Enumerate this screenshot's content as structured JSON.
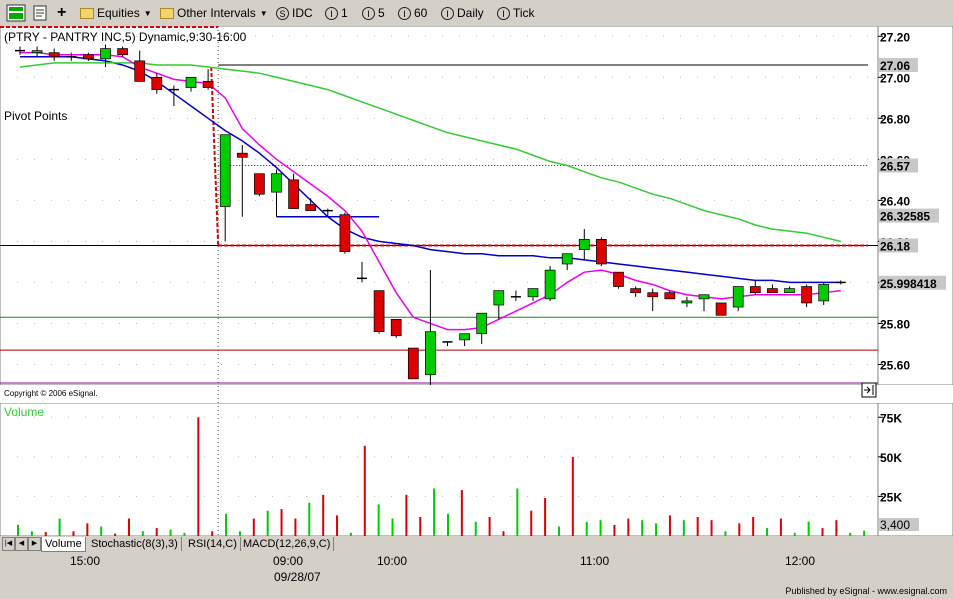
{
  "toolbar": {
    "equities_label": "Equities",
    "intervals_label": "Other Intervals",
    "symbol_btn": "IDC",
    "interval_1": "1",
    "interval_5": "5",
    "interval_60": "60",
    "interval_daily": "Daily",
    "interval_tick": "Tick",
    "symbol_icon": "S",
    "interval_icon": "I"
  },
  "chart": {
    "header": "(PTRY - PANTRY INC,5) Dynamic,9:30-16:00",
    "study_label": "Pivot Points",
    "copyright": "Copyright © 2006 eSignal.",
    "price_ticks": [
      "27.20",
      "27.00",
      "26.80",
      "26.60",
      "26.40",
      "26.20",
      "26.00",
      "25.80",
      "25.60"
    ],
    "price_badges": [
      {
        "label": "27.06",
        "value": 27.06
      },
      {
        "label": "26.57",
        "value": 26.57
      },
      {
        "label": "26.32585",
        "value": 26.32585
      },
      {
        "label": "26.18",
        "value": 26.18
      },
      {
        "label": "25.998418",
        "value": 25.998418
      }
    ]
  },
  "volume": {
    "label": "Volume",
    "ticks": [
      "75K",
      "50K",
      "25K"
    ],
    "last_value": "3,400"
  },
  "tabs": {
    "items": [
      "Volume",
      "Stochastic(8(3),3)",
      "RSI(14,C)",
      "MACD(12,26,9,C)"
    ]
  },
  "xaxis": {
    "labels": [
      "15:00",
      "09:00",
      "10:00",
      "11:00",
      "12:00"
    ],
    "date": "09/28/07"
  },
  "footer": {
    "text": "Published by eSignal - www.esignal.com"
  },
  "colors": {
    "up": "#00cc00",
    "down": "#dd0000",
    "ma_blue": "#0000cc",
    "ma_green": "#33cc33",
    "ma_magenta": "#ee00ee"
  },
  "chart_data": {
    "type": "candlestick",
    "title": "(PTRY - PANTRY INC,5) Dynamic,9:30-16:00",
    "ylim": [
      25.5,
      27.25
    ],
    "candles": [
      {
        "o": 27.13,
        "h": 27.15,
        "l": 27.11,
        "c": 27.13
      },
      {
        "o": 27.12,
        "h": 27.15,
        "l": 27.1,
        "c": 27.13
      },
      {
        "o": 27.12,
        "h": 27.14,
        "l": 27.08,
        "c": 27.1
      },
      {
        "o": 27.1,
        "h": 27.12,
        "l": 27.08,
        "c": 27.1
      },
      {
        "o": 27.11,
        "h": 27.12,
        "l": 27.08,
        "c": 27.09
      },
      {
        "o": 27.09,
        "h": 27.16,
        "l": 27.05,
        "c": 27.14
      },
      {
        "o": 27.14,
        "h": 27.15,
        "l": 27.1,
        "c": 27.11
      },
      {
        "o": 27.08,
        "h": 27.13,
        "l": 26.98,
        "c": 26.98
      },
      {
        "o": 27.0,
        "h": 27.02,
        "l": 26.92,
        "c": 26.94
      },
      {
        "o": 26.94,
        "h": 26.96,
        "l": 26.86,
        "c": 26.94
      },
      {
        "o": 26.95,
        "h": 27.0,
        "l": 26.93,
        "c": 27.0
      },
      {
        "o": 26.98,
        "h": 27.04,
        "l": 26.94,
        "c": 26.95
      },
      {
        "o": 26.37,
        "h": 26.72,
        "l": 26.2,
        "c": 26.72
      },
      {
        "o": 26.63,
        "h": 26.67,
        "l": 26.32,
        "c": 26.61
      },
      {
        "o": 26.53,
        "h": 26.53,
        "l": 26.42,
        "c": 26.43
      },
      {
        "o": 26.44,
        "h": 26.55,
        "l": 26.32,
        "c": 26.53
      },
      {
        "o": 26.5,
        "h": 26.53,
        "l": 26.36,
        "c": 26.36
      },
      {
        "o": 26.38,
        "h": 26.41,
        "l": 26.35,
        "c": 26.35
      },
      {
        "o": 26.35,
        "h": 26.36,
        "l": 26.32,
        "c": 26.35
      },
      {
        "o": 26.33,
        "h": 26.34,
        "l": 26.14,
        "c": 26.15
      },
      {
        "o": 26.02,
        "h": 26.1,
        "l": 26.0,
        "c": 26.02
      },
      {
        "o": 25.96,
        "h": 25.96,
        "l": 25.75,
        "c": 25.76
      },
      {
        "o": 25.82,
        "h": 25.82,
        "l": 25.73,
        "c": 25.74
      },
      {
        "o": 25.68,
        "h": 25.68,
        "l": 25.53,
        "c": 25.53
      },
      {
        "o": 25.55,
        "h": 26.06,
        "l": 25.5,
        "c": 25.76
      },
      {
        "o": 25.71,
        "h": 25.71,
        "l": 25.69,
        "c": 25.71
      },
      {
        "o": 25.72,
        "h": 25.75,
        "l": 25.69,
        "c": 25.75
      },
      {
        "o": 25.75,
        "h": 25.85,
        "l": 25.7,
        "c": 25.85
      },
      {
        "o": 25.89,
        "h": 25.96,
        "l": 25.82,
        "c": 25.96
      },
      {
        "o": 25.93,
        "h": 25.96,
        "l": 25.91,
        "c": 25.93
      },
      {
        "o": 25.93,
        "h": 25.97,
        "l": 25.91,
        "c": 25.97
      },
      {
        "o": 25.92,
        "h": 26.08,
        "l": 25.91,
        "c": 26.06
      },
      {
        "o": 26.09,
        "h": 26.14,
        "l": 26.06,
        "c": 26.14
      },
      {
        "o": 26.16,
        "h": 26.26,
        "l": 26.11,
        "c": 26.21
      },
      {
        "o": 26.21,
        "h": 26.22,
        "l": 26.08,
        "c": 26.09
      },
      {
        "o": 26.05,
        "h": 26.05,
        "l": 25.97,
        "c": 25.98
      },
      {
        "o": 25.97,
        "h": 25.98,
        "l": 25.93,
        "c": 25.95
      },
      {
        "o": 25.95,
        "h": 25.97,
        "l": 25.86,
        "c": 25.93
      },
      {
        "o": 25.95,
        "h": 25.96,
        "l": 25.92,
        "c": 25.92
      },
      {
        "o": 25.9,
        "h": 25.93,
        "l": 25.88,
        "c": 25.91
      },
      {
        "o": 25.92,
        "h": 25.94,
        "l": 25.86,
        "c": 25.94
      },
      {
        "o": 25.9,
        "h": 25.9,
        "l": 25.84,
        "c": 25.84
      },
      {
        "o": 25.88,
        "h": 25.98,
        "l": 25.86,
        "c": 25.98
      },
      {
        "o": 25.98,
        "h": 26.01,
        "l": 25.94,
        "c": 25.95
      },
      {
        "o": 25.97,
        "h": 25.99,
        "l": 25.95,
        "c": 25.95
      },
      {
        "o": 25.95,
        "h": 25.98,
        "l": 25.95,
        "c": 25.97
      },
      {
        "o": 25.98,
        "h": 25.99,
        "l": 25.88,
        "c": 25.9
      },
      {
        "o": 25.91,
        "h": 26.0,
        "l": 25.89,
        "c": 25.99
      },
      {
        "o": 26.0,
        "h": 26.01,
        "l": 25.99,
        "c": 26.0
      }
    ],
    "volume": [
      7000,
      3000,
      2500,
      11000,
      3000,
      8000,
      6000,
      1500,
      11000,
      3000,
      5000,
      4000,
      2000,
      75000,
      3000,
      14000,
      3000,
      11000,
      16000,
      17000,
      11000,
      21000,
      26000,
      13000,
      2000,
      57000,
      20000,
      11000,
      26000,
      12000,
      30000,
      14000,
      29000,
      9000,
      12000,
      3000,
      30000,
      16000,
      24000,
      6000,
      50000,
      9000,
      10000,
      7000,
      11000,
      10000,
      8000,
      13000,
      10000,
      12000,
      10000,
      3000,
      8000,
      12000,
      5000,
      11000,
      2000,
      9000,
      5000,
      10000,
      2000,
      3400
    ],
    "sessions_split_index": 12,
    "horizontal_levels": [
      27.06,
      26.57,
      26.18,
      25.83,
      25.67,
      25.51
    ],
    "moving_averages": [
      {
        "color": "#0000cc",
        "values": [
          27.1,
          27.1,
          27.1,
          27.1,
          27.09,
          27.08,
          27.06,
          27.03,
          26.98,
          26.92,
          26.86,
          26.8,
          26.74,
          26.69,
          26.63,
          26.56,
          26.48,
          26.4,
          26.32,
          26.26,
          26.22,
          26.2,
          26.19,
          26.18,
          26.16,
          26.15,
          26.14,
          26.14,
          26.13,
          26.13,
          26.13,
          26.12,
          26.12,
          26.11,
          26.1,
          26.09,
          26.08,
          26.07,
          26.06,
          26.05,
          26.04,
          26.03,
          26.02,
          26.01,
          26.01,
          26.0,
          26.0,
          26.0,
          26.0
        ]
      },
      {
        "color": "#33cc33",
        "values": [
          27.05,
          27.06,
          27.07,
          27.07,
          27.07,
          27.07,
          27.07,
          27.07,
          27.06,
          27.06,
          27.06,
          27.05,
          27.04,
          27.03,
          27.02,
          27.0,
          26.98,
          26.96,
          26.94,
          26.91,
          26.88,
          26.85,
          26.82,
          26.79,
          26.76,
          26.73,
          26.71,
          26.69,
          26.67,
          26.65,
          26.62,
          26.59,
          26.57,
          26.54,
          26.51,
          26.49,
          26.46,
          26.43,
          26.41,
          26.38,
          26.35,
          26.33,
          26.31,
          26.28,
          26.26,
          26.25,
          26.24,
          26.22,
          26.2
        ]
      },
      {
        "color": "#ee00ee",
        "values": [
          27.12,
          27.12,
          27.11,
          27.11,
          27.11,
          27.11,
          27.1,
          27.05,
          27.02,
          26.99,
          26.98,
          26.97,
          26.9,
          26.75,
          26.67,
          26.6,
          26.54,
          26.48,
          26.42,
          26.35,
          26.25,
          26.1,
          25.95,
          25.83,
          25.8,
          25.77,
          25.77,
          25.78,
          25.82,
          25.86,
          25.9,
          25.94,
          26.0,
          26.05,
          26.06,
          26.04,
          26.01,
          25.99,
          25.96,
          25.94,
          25.93,
          25.92,
          25.93,
          25.94,
          25.94,
          25.94,
          25.94,
          25.95,
          25.96
        ]
      }
    ]
  }
}
